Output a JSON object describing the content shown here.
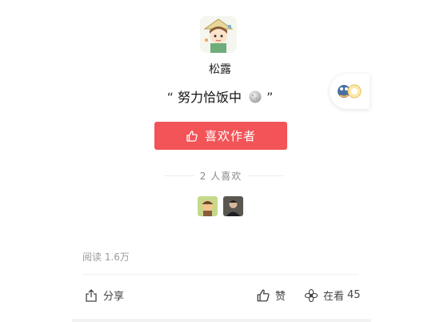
{
  "author": {
    "name": "松露",
    "signature_prefix": "“ ",
    "signature_text": "努力恰饭中",
    "signature_suffix": " ”"
  },
  "like_author_button": {
    "label": "喜欢作者"
  },
  "likers": {
    "summary": "2 人喜欢"
  },
  "stats": {
    "read_label": "阅读",
    "read_count": "1.6万"
  },
  "actions": {
    "share_label": "分享",
    "like_label": "赞",
    "watching_label": "在看",
    "watching_count": "45"
  },
  "colors": {
    "accent": "#f25458",
    "watch_blue": "#3b6fd8"
  },
  "icons": [
    "thumb-up-icon",
    "moon-emoji-icon",
    "share-icon",
    "flower-icon"
  ]
}
